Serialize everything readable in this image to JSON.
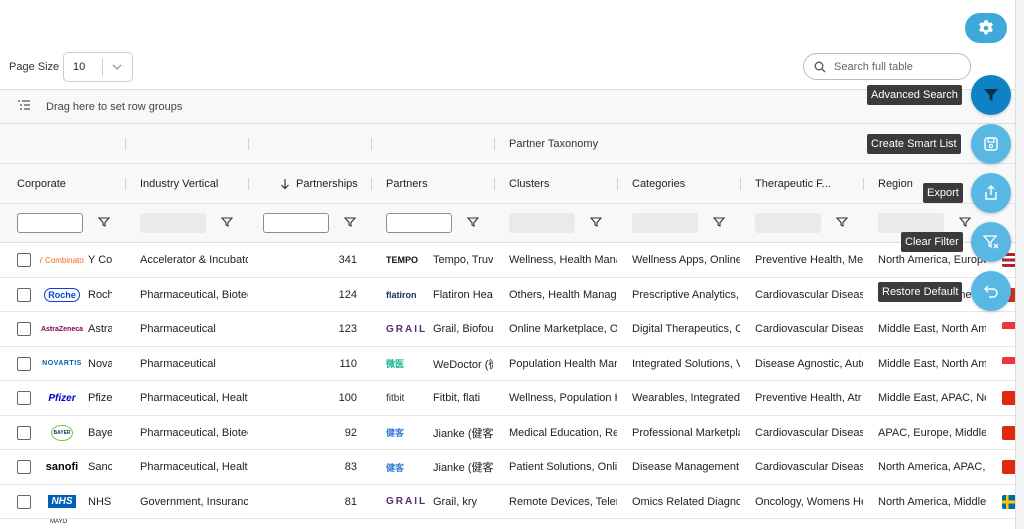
{
  "toolbar": {
    "page_size_label": "Page Size",
    "page_size_value": "10",
    "search_placeholder": "Search full table"
  },
  "group_bar": {
    "label": "Drag here to set row groups"
  },
  "group_header": {
    "partner_taxonomy": "Partner Taxonomy"
  },
  "columns": [
    "Corporate",
    "Industry Vertical",
    "Partnerships",
    "Partners",
    "Clusters",
    "Categories",
    "Therapeutic F...",
    "Region"
  ],
  "sort": {
    "column": "Partnerships",
    "direction": "desc"
  },
  "rows": [
    {
      "logo": "Y Combinator",
      "corporate": "Y Co",
      "vertical": "Accelerator & Incubator",
      "partnerships": "341",
      "partner_logo": "TEMPO",
      "partners": "Tempo, Truv",
      "clusters": "Wellness, Health Management",
      "categories": "Wellness Apps, Online",
      "therapeutic": "Preventive Health, Mental",
      "region": "North America, Europe",
      "flag": "us"
    },
    {
      "logo": "Roche",
      "corporate": "Roch",
      "vertical": "Pharmaceutical, Biotech",
      "partnerships": "124",
      "partner_logo": "flatiron",
      "partners": "Flatiron Hea",
      "clusters": "Others, Health Management",
      "categories": "Prescriptive Analytics,",
      "therapeutic": "Cardiovascular Diseases",
      "region": "Europe, North America",
      "flag": "ch"
    },
    {
      "logo": "AstraZeneca",
      "corporate": "Astra",
      "vertical": "Pharmaceutical",
      "partnerships": "123",
      "partner_logo": "GRAIL",
      "partners": "Grail, Biofount",
      "clusters": "Online Marketplace, O",
      "categories": "Digital Therapeutics, C",
      "therapeutic": "Cardiovascular Diseases",
      "region": "Middle East, North Am",
      "flag": "sg"
    },
    {
      "logo": "NOVARTIS",
      "corporate": "Nova",
      "vertical": "Pharmaceutical",
      "partnerships": "110",
      "partner_logo": "微医",
      "partners": "WeDoctor (微",
      "clusters": "Population Health Management",
      "categories": "Integrated Solutions, V",
      "therapeutic": "Disease Agnostic, Auto",
      "region": "Middle East, North Am",
      "flag": "sg"
    },
    {
      "logo": "Pfizer",
      "corporate": "Pfize",
      "vertical": "Pharmaceutical, Health",
      "partnerships": "100",
      "partner_logo": "fitbit",
      "partners": "Fitbit, flati",
      "clusters": "Wellness, Population Health",
      "categories": "Wearables, Integrated",
      "therapeutic": "Preventive Health, Atr",
      "region": "Middle East, APAC, No",
      "flag": "cn"
    },
    {
      "logo": "BAYER",
      "corporate": "Baye",
      "vertical": "Pharmaceutical, Biotech",
      "partnerships": "92",
      "partner_logo": "健客",
      "partners": "Jianke (健客)",
      "clusters": "Medical Education, Re",
      "categories": "Professional Marketplace",
      "therapeutic": "Cardiovascular Diseases",
      "region": "APAC, Europe, Middle",
      "flag": "cn"
    },
    {
      "logo": "sanofi",
      "corporate": "Sanc",
      "vertical": "Pharmaceutical, Health",
      "partnerships": "83",
      "partner_logo": "健客",
      "partners": "Jianke (健客)",
      "clusters": "Patient Solutions, Online",
      "categories": "Disease Management,",
      "therapeutic": "Cardiovascular Diseases",
      "region": "North America, APAC,",
      "flag": "cn"
    },
    {
      "logo": "NHS",
      "corporate": "NHS",
      "vertical": "Government, Insurance",
      "partnerships": "81",
      "partner_logo": "GRAIL",
      "partners": "Grail, kry",
      "clusters": "Remote Devices, Telemed",
      "categories": "Omics Related Diagnostics",
      "therapeutic": "Oncology, Womens Health",
      "region": "North America, Middle",
      "flag": "se"
    }
  ],
  "partial_row_logo": "MAYO",
  "actions": [
    {
      "name": "advanced-search",
      "tooltip": "Advanced Search",
      "icon": "funnel-icon"
    },
    {
      "name": "create-smart-list",
      "tooltip": "Create Smart List",
      "icon": "save-icon"
    },
    {
      "name": "export",
      "tooltip": "Export",
      "icon": "share-icon"
    },
    {
      "name": "clear-filter",
      "tooltip": "Clear Filter",
      "icon": "funnel-clear-icon"
    },
    {
      "name": "restore-default",
      "tooltip": "Restore Default",
      "icon": "undo-icon"
    }
  ],
  "colors": {
    "accent": "#3fa9dc",
    "fab": "#59b8e3",
    "fab_active": "#0e82c4"
  }
}
